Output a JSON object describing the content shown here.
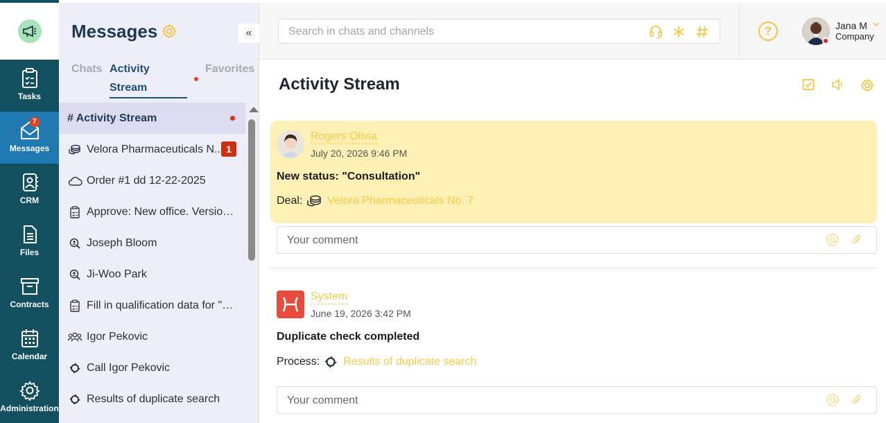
{
  "rail": {
    "items": [
      {
        "label": "Tasks",
        "icon": "tasks-icon"
      },
      {
        "label": "Messages",
        "icon": "messages-icon",
        "badge": "7",
        "active": true
      },
      {
        "label": "CRM",
        "icon": "crm-icon"
      },
      {
        "label": "Files",
        "icon": "files-icon"
      },
      {
        "label": "Contracts",
        "icon": "contracts-icon"
      },
      {
        "label": "Calendar",
        "icon": "calendar-icon"
      },
      {
        "label": "Administration",
        "icon": "administration-icon"
      }
    ]
  },
  "sidebar": {
    "title": "Messages",
    "collapse_label": "«",
    "tabs": {
      "chats": "Chats",
      "activity_line1": "Activity",
      "activity_line2": "Stream",
      "favorites": "Favorites"
    },
    "chats": [
      {
        "label": "# Activity Stream",
        "icon": "",
        "selected": true,
        "unread_dot": true
      },
      {
        "label": "Velora Pharmaceuticals N...",
        "icon": "coins-icon",
        "count": "1"
      },
      {
        "label": "Order #1 dd 12-22-2025",
        "icon": "cloud-icon"
      },
      {
        "label": "Approve: New office. Version: ...",
        "icon": "clipboard-icon"
      },
      {
        "label": "Joseph Bloom",
        "icon": "search-person-icon"
      },
      {
        "label": "Ji-Woo Park",
        "icon": "search-person-icon"
      },
      {
        "label": "Fill in qualification data for \"Ji-...",
        "icon": "clipboard-icon"
      },
      {
        "label": "Igor Pekovic",
        "icon": "people-icon"
      },
      {
        "label": "Call Igor Pekovic",
        "icon": "process-icon"
      },
      {
        "label": "Results of duplicate search",
        "icon": "process-icon"
      }
    ]
  },
  "topbar": {
    "search_placeholder": "Search in chats and channels",
    "help_label": "?",
    "user_name": "Jana M",
    "user_company": "Company"
  },
  "main": {
    "title": "Activity Stream",
    "posts": [
      {
        "author": "Rogers Olivia",
        "time": "July 20, 2026 9:46 PM",
        "text": "New status: \"Consultation\"",
        "meta_label": "Deal:",
        "meta_link": "Velora Pharmaceuticals No. 7",
        "comment_placeholder": "Your comment"
      },
      {
        "author": "System",
        "time": "June 19, 2026 3:42 PM",
        "text": "Duplicate check completed",
        "meta_label": "Process:",
        "meta_link": "Results of duplicate search",
        "comment_placeholder": "Your comment"
      }
    ]
  },
  "colors": {
    "rail": "#13505f",
    "rail_active": "#2079b0",
    "accent_yellow": "#f5c542",
    "post_highlight": "#fdf0b4",
    "badge_red": "#cc2e10"
  }
}
